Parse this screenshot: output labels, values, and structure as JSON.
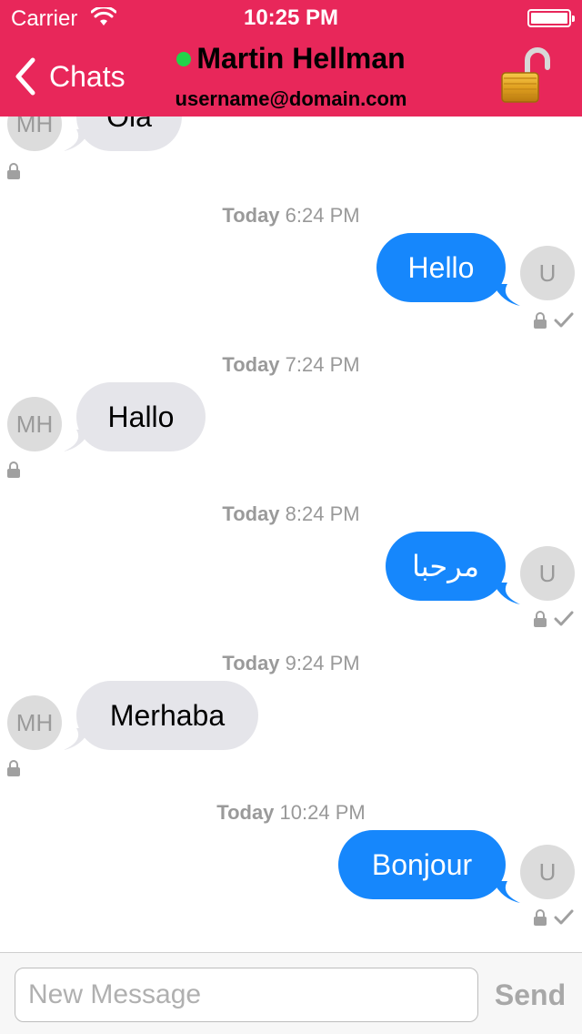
{
  "status_bar": {
    "carrier": "Carrier",
    "time": "10:25 PM"
  },
  "header": {
    "back_label": "Chats",
    "contact_name": "Martin Hellman",
    "contact_subtitle": "username@domain.com",
    "online": true,
    "accent_color": "#e8275a",
    "online_color": "#22d34a"
  },
  "colors": {
    "outgoing_bubble": "#1687fc",
    "incoming_bubble": "#e5e5ea"
  },
  "messages": [
    {
      "direction": "in",
      "avatar": "MH",
      "text": "Ola",
      "encrypted": true
    },
    {
      "timestamp_day": "Today",
      "timestamp_time": "6:24 PM"
    },
    {
      "direction": "out",
      "avatar": "U",
      "text": "Hello",
      "encrypted": true,
      "delivered": true
    },
    {
      "timestamp_day": "Today",
      "timestamp_time": "7:24 PM"
    },
    {
      "direction": "in",
      "avatar": "MH",
      "text": "Hallo",
      "encrypted": true
    },
    {
      "timestamp_day": "Today",
      "timestamp_time": "8:24 PM"
    },
    {
      "direction": "out",
      "avatar": "U",
      "text": "مرحبا",
      "encrypted": true,
      "delivered": true
    },
    {
      "timestamp_day": "Today",
      "timestamp_time": "9:24 PM"
    },
    {
      "direction": "in",
      "avatar": "MH",
      "text": "Merhaba",
      "encrypted": true
    },
    {
      "timestamp_day": "Today",
      "timestamp_time": "10:24 PM"
    },
    {
      "direction": "out",
      "avatar": "U",
      "text": "Bonjour",
      "encrypted": true,
      "delivered": true
    }
  ],
  "composer": {
    "placeholder": "New Message",
    "value": "",
    "send_label": "Send"
  },
  "icons": {
    "wifi": "wifi-icon",
    "battery": "battery-icon",
    "back": "chevron-left-icon",
    "encryption_toggle": "unlocked-padlock-icon",
    "message_lock": "lock-icon",
    "delivered": "checkmark-icon"
  }
}
